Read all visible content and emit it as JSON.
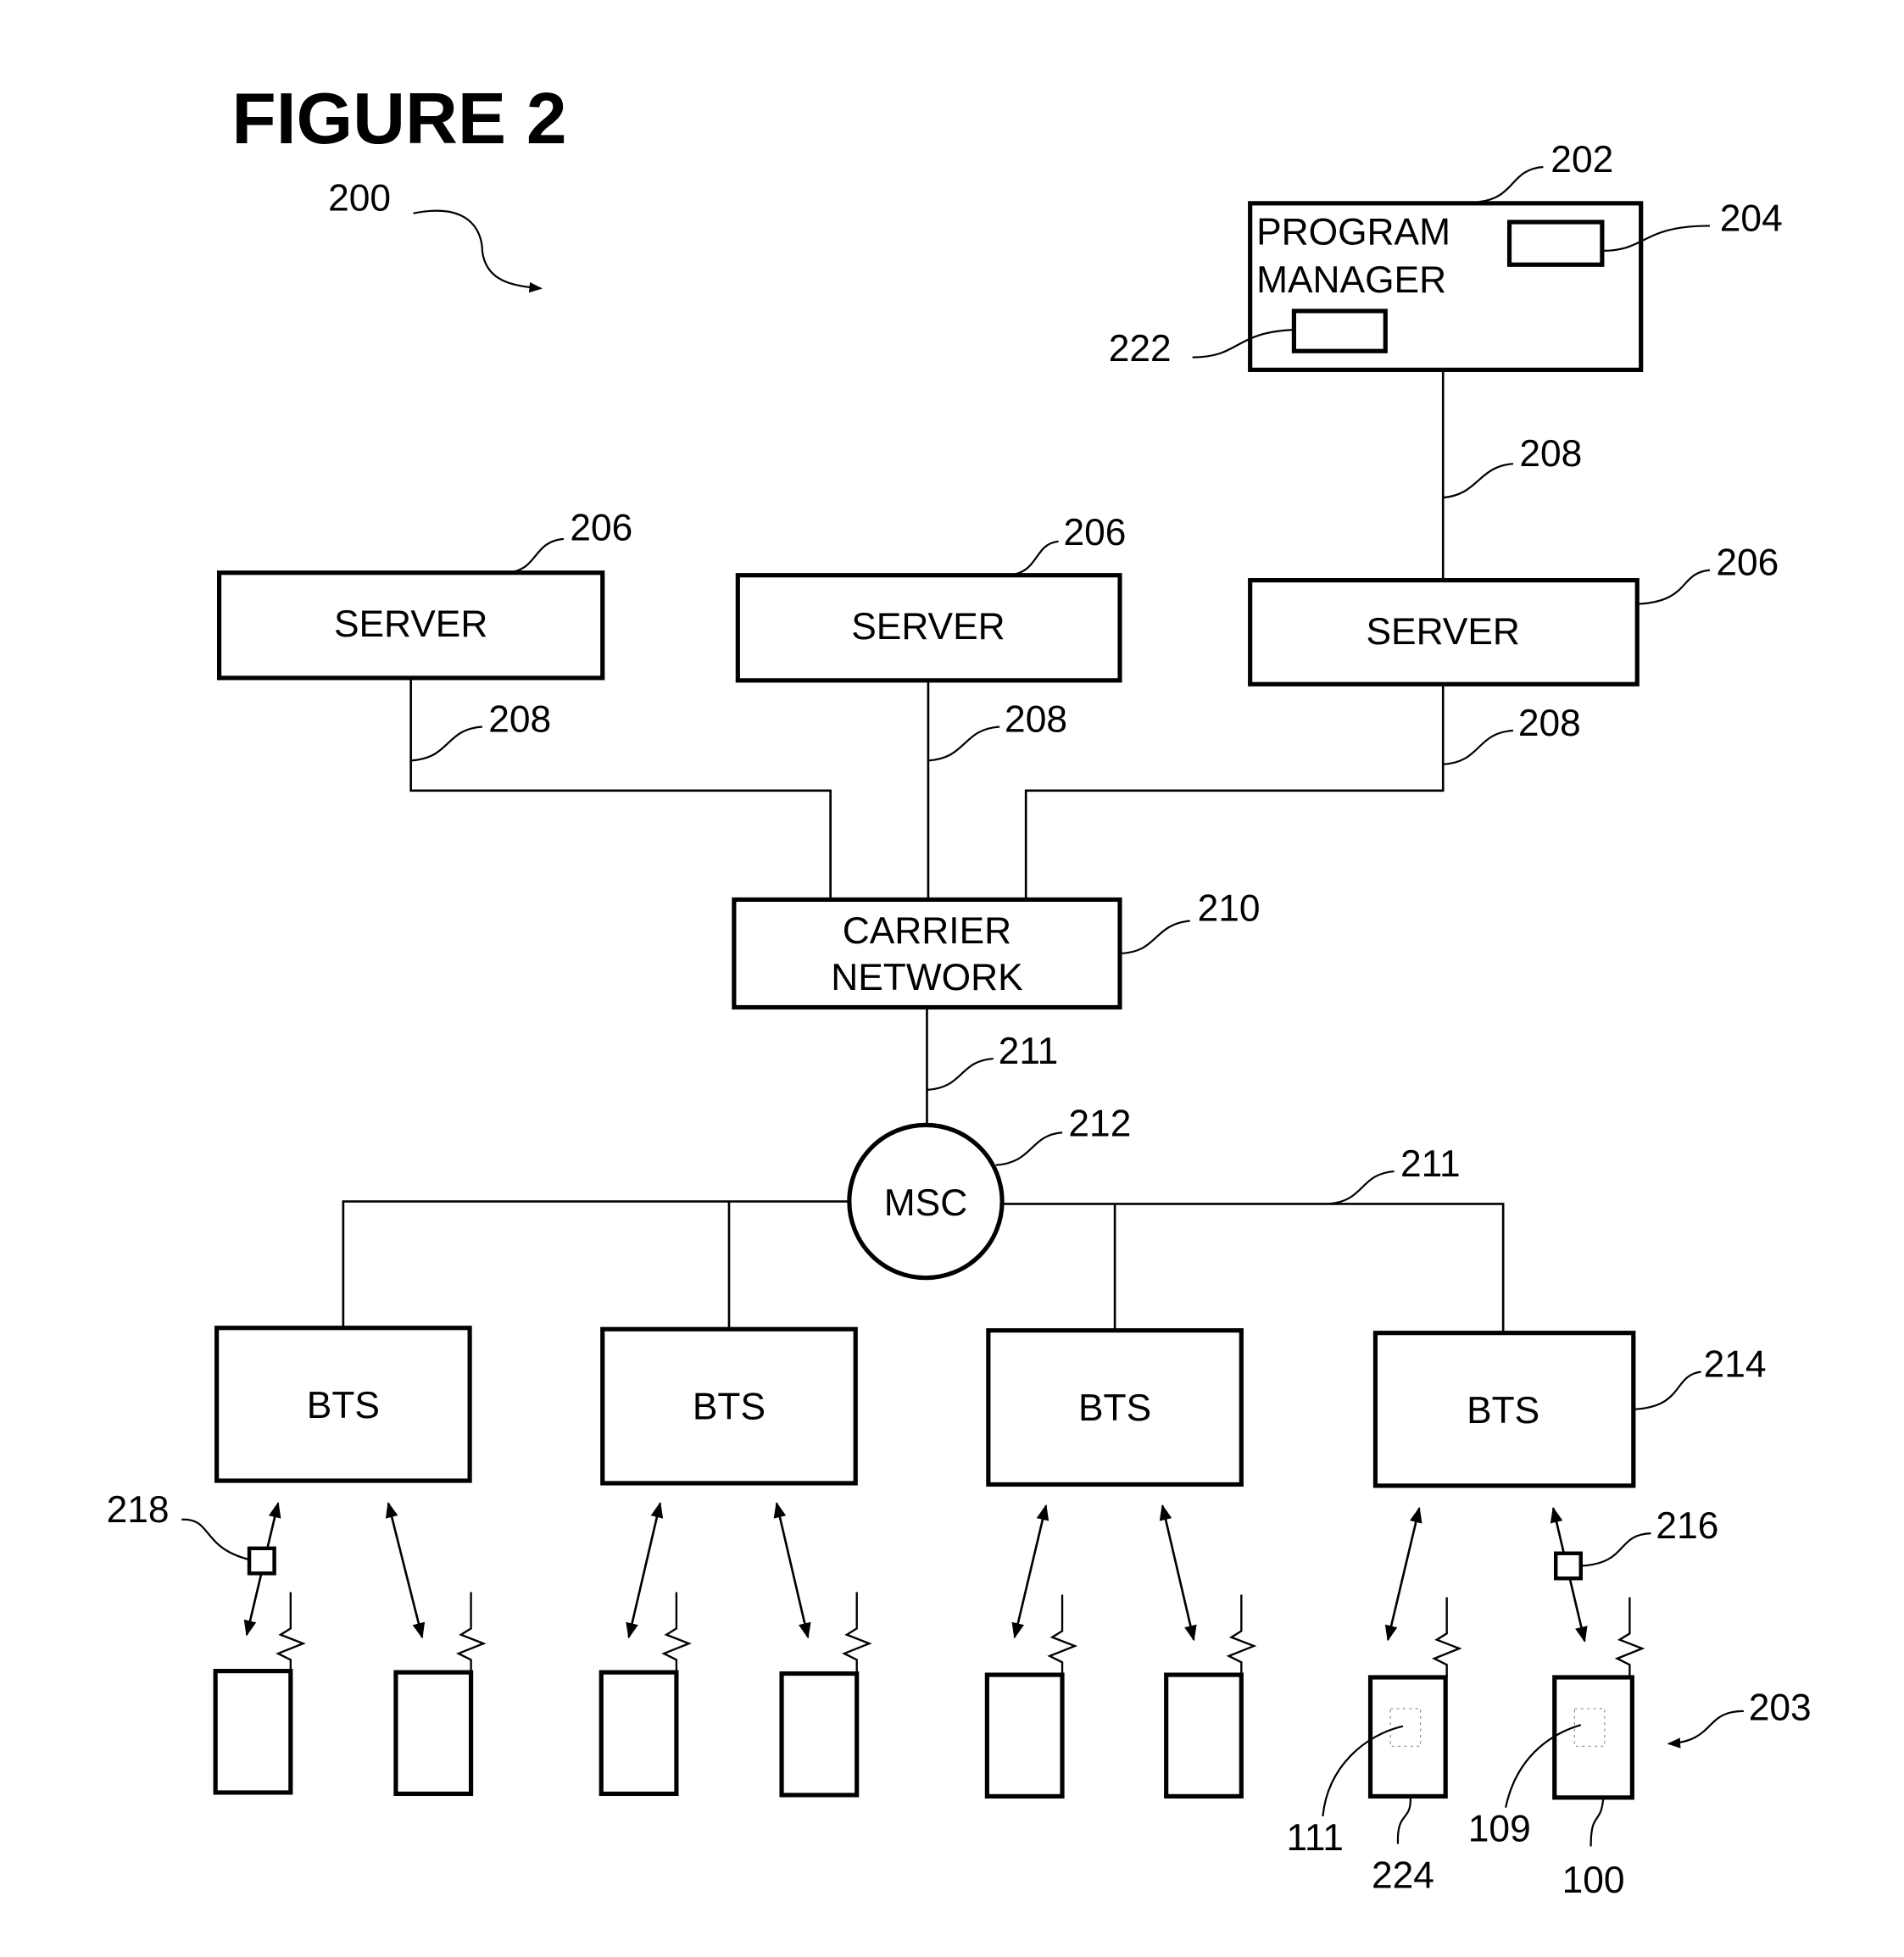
{
  "figure": {
    "title": "FIGURE 2",
    "system_ref": "200"
  },
  "program_manager": {
    "label_line1": "PROGRAM",
    "label_line2": "MANAGER",
    "ref": "202",
    "sub_box_top_ref": "204",
    "sub_box_bottom_ref": "222"
  },
  "servers": [
    {
      "label": "SERVER",
      "ref": "206",
      "link_ref": "208"
    },
    {
      "label": "SERVER",
      "ref": "206",
      "link_ref": "208"
    },
    {
      "label": "SERVER",
      "ref": "206",
      "link_ref": "208"
    }
  ],
  "pm_link_ref": "208",
  "carrier_network": {
    "label_line1": "CARRIER",
    "label_line2": "NETWORK",
    "ref": "210"
  },
  "carrier_msc_link_ref": "211",
  "msc": {
    "label": "MSC",
    "ref": "212",
    "bts_link_ref": "211"
  },
  "bts": [
    {
      "label": "BTS"
    },
    {
      "label": "BTS"
    },
    {
      "label": "BTS"
    },
    {
      "label": "BTS",
      "ref": "214"
    }
  ],
  "annotations": {
    "data_packet_left_ref": "218",
    "data_packet_right_ref": "216",
    "devices_group_ref": "203",
    "device_a_ref": "224",
    "device_a_inner_ref": "111",
    "device_b_ref": "100",
    "device_b_inner_ref": "109"
  }
}
